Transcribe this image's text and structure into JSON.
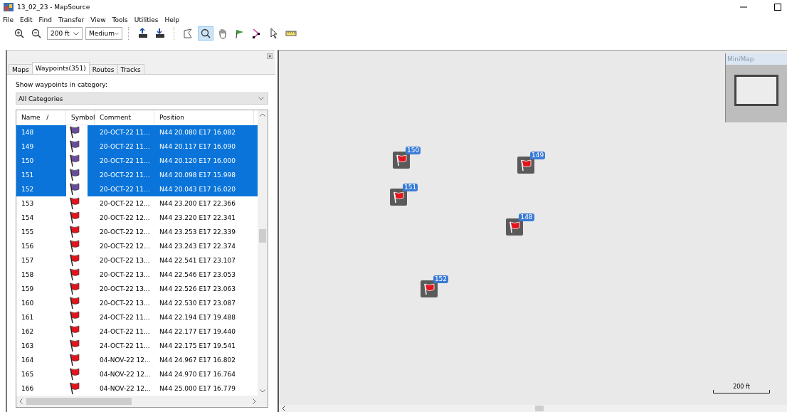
{
  "window": {
    "title": "13_02_23 - MapSource"
  },
  "menu": [
    "File",
    "Edit",
    "Find",
    "Transfer",
    "View",
    "Tools",
    "Utilities",
    "Help"
  ],
  "toolbar": {
    "scale": "200 ft",
    "detail": "Medium",
    "tools": [
      {
        "kind": "zoom-in",
        "selected": false
      },
      {
        "kind": "zoom-out",
        "selected": false
      },
      {
        "kind": "upload",
        "selected": false
      },
      {
        "kind": "download",
        "selected": false
      },
      {
        "kind": "polygon",
        "selected": false
      },
      {
        "kind": "zoom",
        "selected": true
      },
      {
        "kind": "hand",
        "selected": false
      },
      {
        "kind": "waypoint",
        "selected": false
      },
      {
        "kind": "route",
        "selected": false
      },
      {
        "kind": "pointer",
        "selected": false
      },
      {
        "kind": "ruler",
        "selected": false
      }
    ]
  },
  "tabs": [
    {
      "label": "Maps",
      "selected": false
    },
    {
      "label": "Waypoints(351)",
      "selected": true
    },
    {
      "label": "Routes",
      "selected": false
    },
    {
      "label": "Tracks",
      "selected": false
    }
  ],
  "category": {
    "label": "Show waypoints in category:",
    "value": "All Categories"
  },
  "table": {
    "columns": [
      "Name   /",
      "Symbol",
      "Comment",
      "Position"
    ],
    "rows": [
      {
        "name": "148",
        "comment": "20-OCT-22 11...",
        "position": "N44 20.080 E17 16.082",
        "selected": true
      },
      {
        "name": "149",
        "comment": "20-OCT-22 11...",
        "position": "N44 20.117 E17 16.090",
        "selected": true
      },
      {
        "name": "150",
        "comment": "20-OCT-22 11...",
        "position": "N44 20.120 E17 16.000",
        "selected": true
      },
      {
        "name": "151",
        "comment": "20-OCT-22 11...",
        "position": "N44 20.098 E17 15.998",
        "selected": true
      },
      {
        "name": "152",
        "comment": "20-OCT-22 11...",
        "position": "N44 20.043 E17 16.020",
        "selected": true
      },
      {
        "name": "153",
        "comment": "20-OCT-22 12...",
        "position": "N44 23.200 E17 22.366",
        "selected": false
      },
      {
        "name": "154",
        "comment": "20-OCT-22 12...",
        "position": "N44 23.220 E17 22.341",
        "selected": false
      },
      {
        "name": "155",
        "comment": "20-OCT-22 12...",
        "position": "N44 23.253 E17 22.339",
        "selected": false
      },
      {
        "name": "156",
        "comment": "20-OCT-22 12...",
        "position": "N44 23.243 E17 22.374",
        "selected": false
      },
      {
        "name": "157",
        "comment": "20-OCT-22 13...",
        "position": "N44 22.541 E17 23.107",
        "selected": false
      },
      {
        "name": "158",
        "comment": "20-OCT-22 13...",
        "position": "N44 22.546 E17 23.053",
        "selected": false
      },
      {
        "name": "159",
        "comment": "20-OCT-22 13...",
        "position": "N44 22.526 E17 23.063",
        "selected": false
      },
      {
        "name": "160",
        "comment": "20-OCT-22 13...",
        "position": "N44 22.530 E17 23.087",
        "selected": false
      },
      {
        "name": "161",
        "comment": "24-OCT-22 11...",
        "position": "N44 22.194 E17 19.488",
        "selected": false
      },
      {
        "name": "162",
        "comment": "24-OCT-22 11...",
        "position": "N44 22.177 E17 19.440",
        "selected": false
      },
      {
        "name": "163",
        "comment": "24-OCT-22 11...",
        "position": "N44 22.175 E17 19.541",
        "selected": false
      },
      {
        "name": "164",
        "comment": "04-NOV-22 12...",
        "position": "N44 24.967 E17 16.802",
        "selected": false
      },
      {
        "name": "165",
        "comment": "04-NOV-22 12...",
        "position": "N44 24.970 E17 16.764",
        "selected": false
      },
      {
        "name": "166",
        "comment": "04-NOV-22 12...",
        "position": "N44 25.000 E17 16.779",
        "selected": false
      }
    ]
  },
  "map": {
    "markers": [
      {
        "label": "148"
      },
      {
        "label": "149"
      },
      {
        "label": "150"
      },
      {
        "label": "151"
      },
      {
        "label": "152"
      }
    ],
    "minimap": {
      "title": "MiniMap"
    },
    "scale": "200 ft"
  }
}
